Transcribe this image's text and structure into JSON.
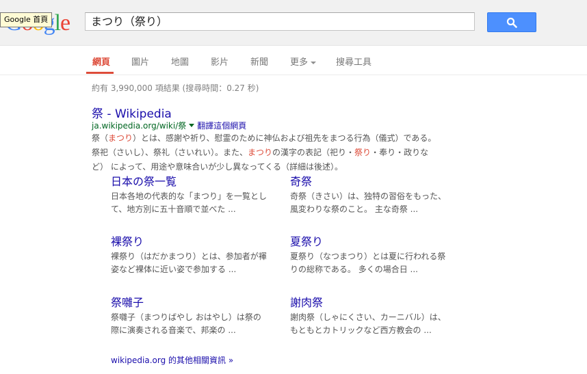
{
  "header": {
    "logo_letters": [
      "G",
      "o",
      "o",
      "g",
      "l",
      "e"
    ],
    "tooltip": "Google 首頁",
    "search_value": "まつり（祭り）",
    "search_icon": "magnifier-icon"
  },
  "tabs": [
    {
      "label": "網頁"
    },
    {
      "label": "圖片"
    },
    {
      "label": "地圖"
    },
    {
      "label": "影片"
    },
    {
      "label": "新聞"
    },
    {
      "label": "更多"
    },
    {
      "label": "搜尋工具"
    }
  ],
  "stats": "約有 3,990,000 項結果 (搜尋時間：0.27 秒)",
  "result": {
    "title": "祭 - Wikipedia",
    "url": "ja.wikipedia.org/wiki/祭",
    "translate": "翻譯這個網頁",
    "snippet_parts": [
      "祭（",
      "まつり",
      "）とは、感謝や祈り、慰霊のために神仏および祖先をまつる行為（儀式）である。祭祀（さいし）、祭礼（さいれい）。また、",
      "まつり",
      "の漢字の表記（祀り・",
      "祭り",
      "・奉り・政りなど） によって、用途や意味合いが少し異なってくる（詳細は後述）。"
    ]
  },
  "sitelinks": [
    {
      "title": "日本の祭一覧",
      "desc": "日本各地の代表的な「まつり」を一覧として、地方別に五十音順で並べた ..."
    },
    {
      "title": "奇祭",
      "desc": "奇祭（きさい）は、独特の習俗をもった、風変わりな祭のこと。 主な奇祭 ..."
    },
    {
      "title": "裸祭り",
      "desc": "裸祭り（はだかまつり）とは、参加者が褌姿など裸体に近い姿で参加する ..."
    },
    {
      "title": "夏祭り",
      "desc": "夏祭り（なつまつり）とは夏に行われる祭りの総称である。 多くの場合日 ..."
    },
    {
      "title": "祭囃子",
      "desc": "祭囃子（まつりばやし おはやし）は祭の際に演奏される音楽で、邦楽の ..."
    },
    {
      "title": "謝肉祭",
      "desc": "謝肉祭（しゃにくさい、カーニバル）は、もともとカトリックなど西方教会の ..."
    }
  ],
  "more_link": "wikipedia.org 的其他相關資訊 »",
  "colors": {
    "accent": "#dd4b39",
    "link": "#1a0dab",
    "url": "#006621",
    "button": "#4d90fe"
  }
}
